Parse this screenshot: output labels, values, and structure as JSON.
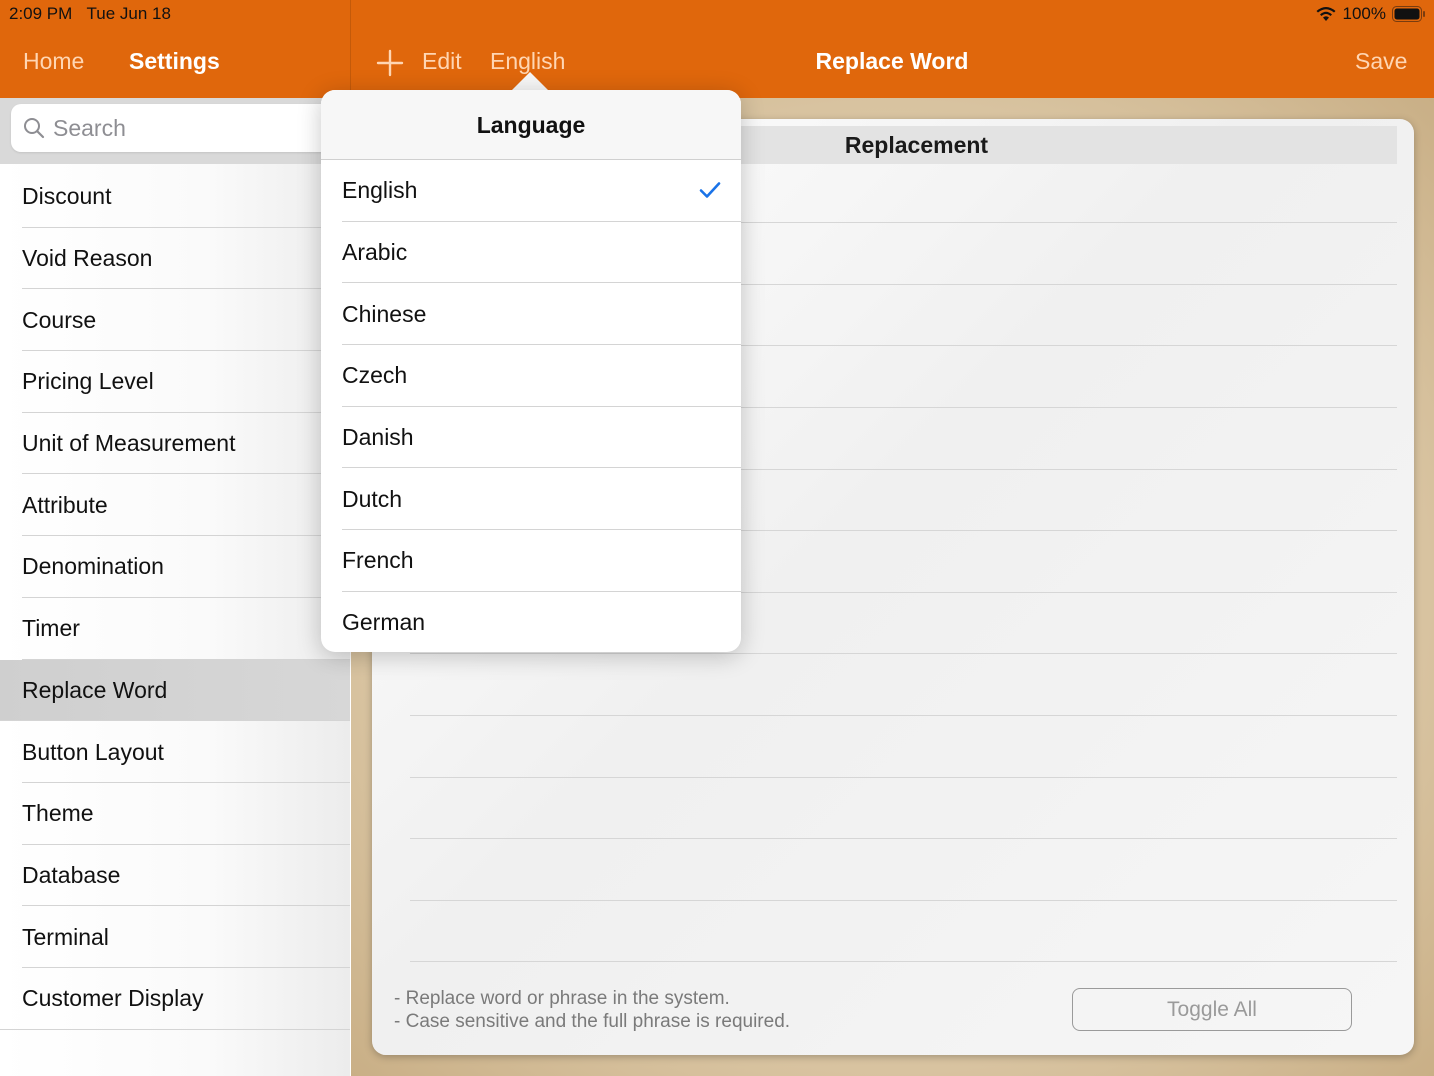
{
  "status": {
    "time": "2:09 PM",
    "date": "Tue Jun 18",
    "battery": "100%"
  },
  "nav": {
    "home": "Home",
    "settings": "Settings",
    "edit": "Edit",
    "language": "English",
    "title": "Replace Word",
    "save": "Save"
  },
  "search": {
    "placeholder": "Search"
  },
  "sidebar": {
    "items": [
      {
        "label": "Discount"
      },
      {
        "label": "Void Reason"
      },
      {
        "label": "Course"
      },
      {
        "label": "Pricing Level"
      },
      {
        "label": "Unit of Measurement"
      },
      {
        "label": "Attribute"
      },
      {
        "label": "Denomination"
      },
      {
        "label": "Timer"
      },
      {
        "label": "Replace Word",
        "selected": true
      },
      {
        "label": "Button Layout"
      },
      {
        "label": "Theme"
      },
      {
        "label": "Database"
      },
      {
        "label": "Terminal"
      },
      {
        "label": "Customer Display"
      }
    ]
  },
  "main": {
    "column_header": "Replacement",
    "hint_line1": "- Replace word or phrase in the system.",
    "hint_line2": "- Case sensitive and the full phrase is required.",
    "toggle_all": "Toggle All"
  },
  "popover": {
    "title": "Language",
    "selected": "English",
    "options": [
      {
        "label": "English"
      },
      {
        "label": "Arabic"
      },
      {
        "label": "Chinese"
      },
      {
        "label": "Czech"
      },
      {
        "label": "Danish"
      },
      {
        "label": "Dutch"
      },
      {
        "label": "French"
      },
      {
        "label": "German"
      }
    ]
  },
  "colors": {
    "nav_bar": "#e0670c",
    "accent_check": "#1a73e8"
  }
}
